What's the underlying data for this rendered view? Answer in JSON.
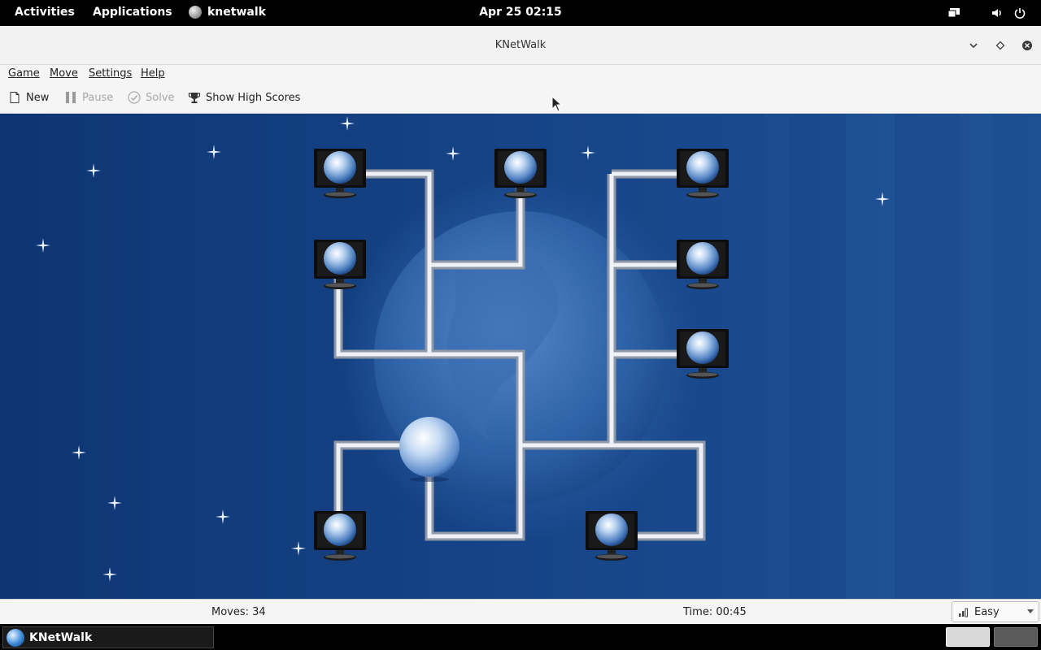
{
  "topbar": {
    "activities": "Activities",
    "applications": "Applications",
    "app_name": "knetwalk",
    "clock": "Apr 25  02:15",
    "tray_icons": [
      "display-icon",
      "volume-icon",
      "power-icon"
    ]
  },
  "window": {
    "title": "KNetWalk",
    "controls": [
      "minimize-icon",
      "maximize-icon",
      "close-icon"
    ]
  },
  "menubar": {
    "items": [
      "Game",
      "Move",
      "Settings",
      "Help"
    ]
  },
  "toolbar": {
    "new_label": "New",
    "pause_label": "Pause",
    "solve_label": "Solve",
    "highscores_label": "Show High Scores"
  },
  "status": {
    "moves": "Moves: 34",
    "time": "Time: 00:45",
    "difficulty": "Easy"
  },
  "taskbar": {
    "app_label": "KNetWalk"
  },
  "colors": {
    "background": "#123d7a",
    "pipe": "#e6e9ee",
    "toolbar": "#f5f5f5"
  }
}
